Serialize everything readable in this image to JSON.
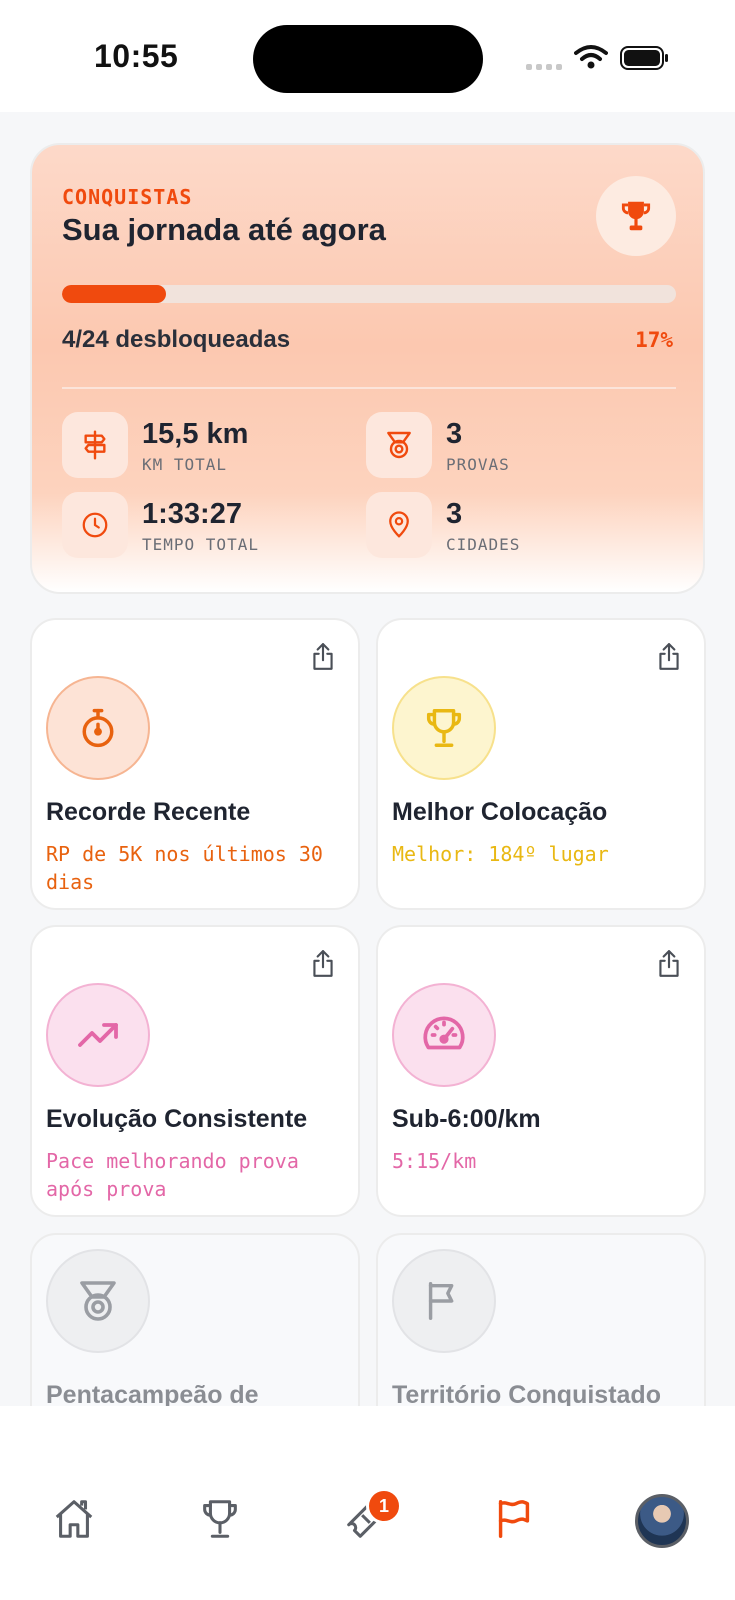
{
  "status_bar": {
    "time": "10:55"
  },
  "summary": {
    "eyebrow": "CONQUISTAS",
    "title": "Sua jornada até agora",
    "progress_fraction": 0.17,
    "progress_text": "4/24 desbloqueadas",
    "progress_percent": "17%",
    "stats": [
      {
        "value": "15,5 km",
        "label": "KM TOTAL",
        "icon": "signpost-icon"
      },
      {
        "value": "3",
        "label": "PROVAS",
        "icon": "medal-icon"
      },
      {
        "value": "1:33:27",
        "label": "TEMPO TOTAL",
        "icon": "clock-icon"
      },
      {
        "value": "3",
        "label": "CIDADES",
        "icon": "map-pin-icon"
      }
    ]
  },
  "achievements": [
    {
      "title": "Recorde Recente",
      "subtitle": "RP de 5K nos últimos 30 dias",
      "icon": "stopwatch-icon",
      "color": "#e8620f",
      "bg": "#fde3d6",
      "state": "unlocked"
    },
    {
      "title": "Melhor Colocação",
      "subtitle": "Melhor: 184º lugar",
      "icon": "trophy-icon",
      "color": "#e9b813",
      "bg": "#fdf5cf",
      "state": "unlocked"
    },
    {
      "title": "Evolução Consistente",
      "subtitle": "Pace melhorando prova após prova",
      "icon": "trending-up-icon",
      "color": "#e367a7",
      "bg": "#fbe0ee",
      "state": "unlocked"
    },
    {
      "title": "Sub-6:00/km",
      "subtitle": "5:15/km",
      "icon": "speedometer-icon",
      "color": "#e367a7",
      "bg": "#fbe0ee",
      "state": "unlocked"
    },
    {
      "title": "Pentacampeão de",
      "icon": "medal-icon",
      "state": "locked"
    },
    {
      "title": "Território Conquistado",
      "icon": "flag-icon",
      "state": "locked"
    }
  ],
  "nav": {
    "items": [
      "home-icon",
      "trophy-icon",
      "ticket-icon",
      "flag-icon",
      "avatar"
    ],
    "active": "flag-icon",
    "badge_count": "1"
  },
  "colors": {
    "accent": "#f04a0e",
    "inactive": "#5b5f66"
  }
}
